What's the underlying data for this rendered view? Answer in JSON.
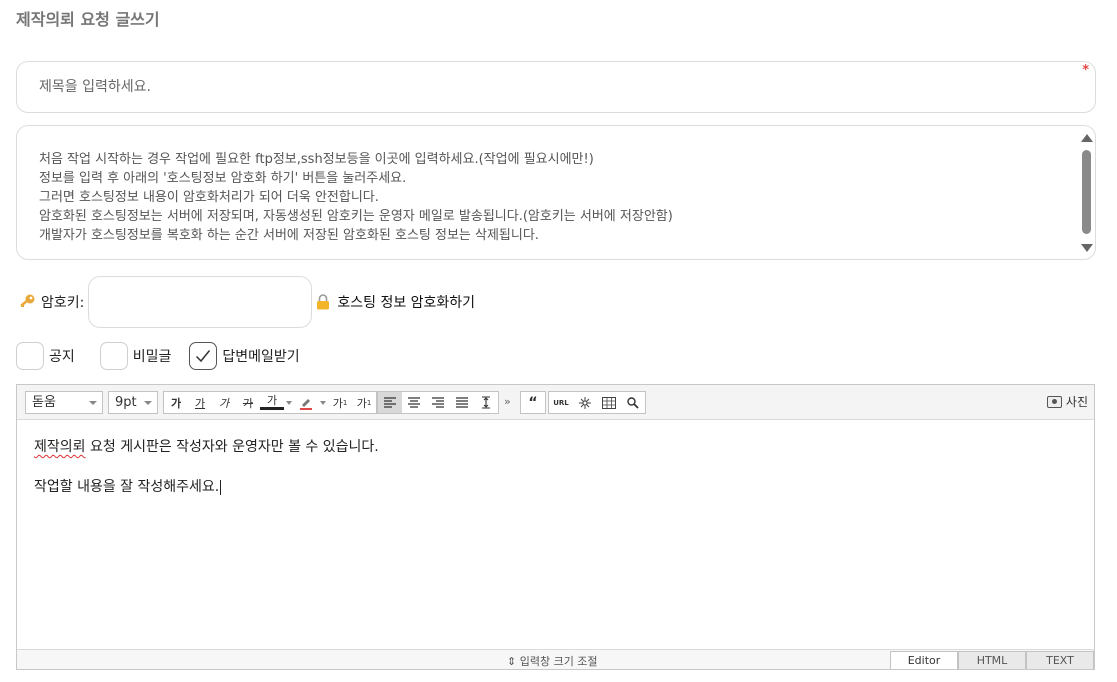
{
  "page": {
    "title": "제작의뢰 요청 글쓰기"
  },
  "title_field": {
    "placeholder": "제목을 입력하세요.",
    "required_mark": "*"
  },
  "hosting_info": {
    "lines": [
      "처음 작업 시작하는 경우 작업에 필요한 ftp정보,ssh정보등을 이곳에 입력하세요.(작업에 필요시에만!)",
      "정보를 입력 후 아래의 '호스팅정보 암호화 하기' 버튼을 눌러주세요.",
      "그러면 호스팅정보 내용이 암호화처리가 되어 더욱 안전합니다.",
      "암호화된 호스팅정보는 서버에 저장되며, 자동생성된 암호키는 운영자 메일로 발송됩니다.(암호키는 서버에 저장안함)",
      "개발자가 호스팅정보를 복호화 하는 순간 서버에 저장된 암호화된 호스팅 정보는 삭제됩니다."
    ]
  },
  "encryption": {
    "key_label": "암호키:",
    "key_value": "",
    "encrypt_button": "호스팅 정보 암호화하기"
  },
  "options": [
    {
      "label": "공지",
      "checked": false
    },
    {
      "label": "비밀글",
      "checked": false
    },
    {
      "label": "답변메일받기",
      "checked": true
    }
  ],
  "editor": {
    "toolbar": {
      "font_family": "돋움",
      "font_size": "9pt",
      "format_buttons": [
        "가",
        "가",
        "가",
        "가",
        "가"
      ],
      "sup_label": "가",
      "sub_label": "가",
      "quote_label": "“",
      "url_label": "URL",
      "photo_label": "사진"
    },
    "content": {
      "line1_underlined": "제작의뢰",
      "line1_rest": " 요청 게시판은 작성자와 운영자만 볼 수 있습니다.",
      "line2": "작업할 내용을 잘 작성해주세요."
    },
    "resize_label": "⇕ 입력창 크기 조절",
    "modes": [
      "Editor",
      "HTML",
      "TEXT"
    ],
    "active_mode": "Editor"
  },
  "colors": {
    "required": "#e04848",
    "border": "#dcdcdc",
    "spell_error": "#e03030"
  }
}
